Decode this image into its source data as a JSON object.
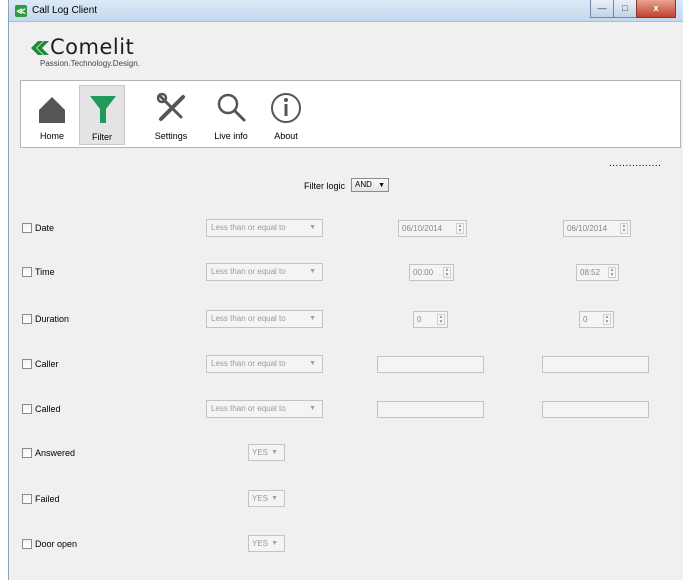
{
  "window": {
    "title": "Call Log Client",
    "app_icon_glyph": "≪",
    "controls": {
      "minimize": "—",
      "maximize": "□",
      "close": "x"
    }
  },
  "brand": {
    "name": "Comelit",
    "tagline": "Passion.Technology.Design.",
    "accent_color": "#1f8a37"
  },
  "toolbar": {
    "items": [
      {
        "label": "Home",
        "icon": "home-icon",
        "active": false
      },
      {
        "label": "Filter",
        "icon": "filter-icon",
        "active": true
      },
      {
        "label": "Settings",
        "icon": "tools-icon",
        "active": false
      },
      {
        "label": "Live info",
        "icon": "search-icon",
        "active": false
      },
      {
        "label": "About",
        "icon": "info-icon",
        "active": false
      }
    ]
  },
  "status": {
    "dots": "................"
  },
  "filter": {
    "logic_label": "Filter logic",
    "logic_value": "AND",
    "rows": {
      "date": {
        "label": "Date",
        "operator": "Less than or equal to",
        "from": "06/10/2014",
        "to": "06/10/2014"
      },
      "time": {
        "label": "Time",
        "operator": "Less than or equal to",
        "from": "00:00",
        "to": "08:52"
      },
      "duration": {
        "label": "Duration",
        "operator": "Less than or equal to",
        "from": "0",
        "to": "0"
      },
      "caller": {
        "label": "Caller",
        "operator": "Less than or equal to",
        "from": "",
        "to": ""
      },
      "called": {
        "label": "Called",
        "operator": "Less than or equal to",
        "from": "",
        "to": ""
      },
      "answered": {
        "label": "Answered",
        "value": "YES"
      },
      "failed": {
        "label": "Failed",
        "value": "YES"
      },
      "door_open": {
        "label": "Door open",
        "value": "YES"
      }
    }
  }
}
